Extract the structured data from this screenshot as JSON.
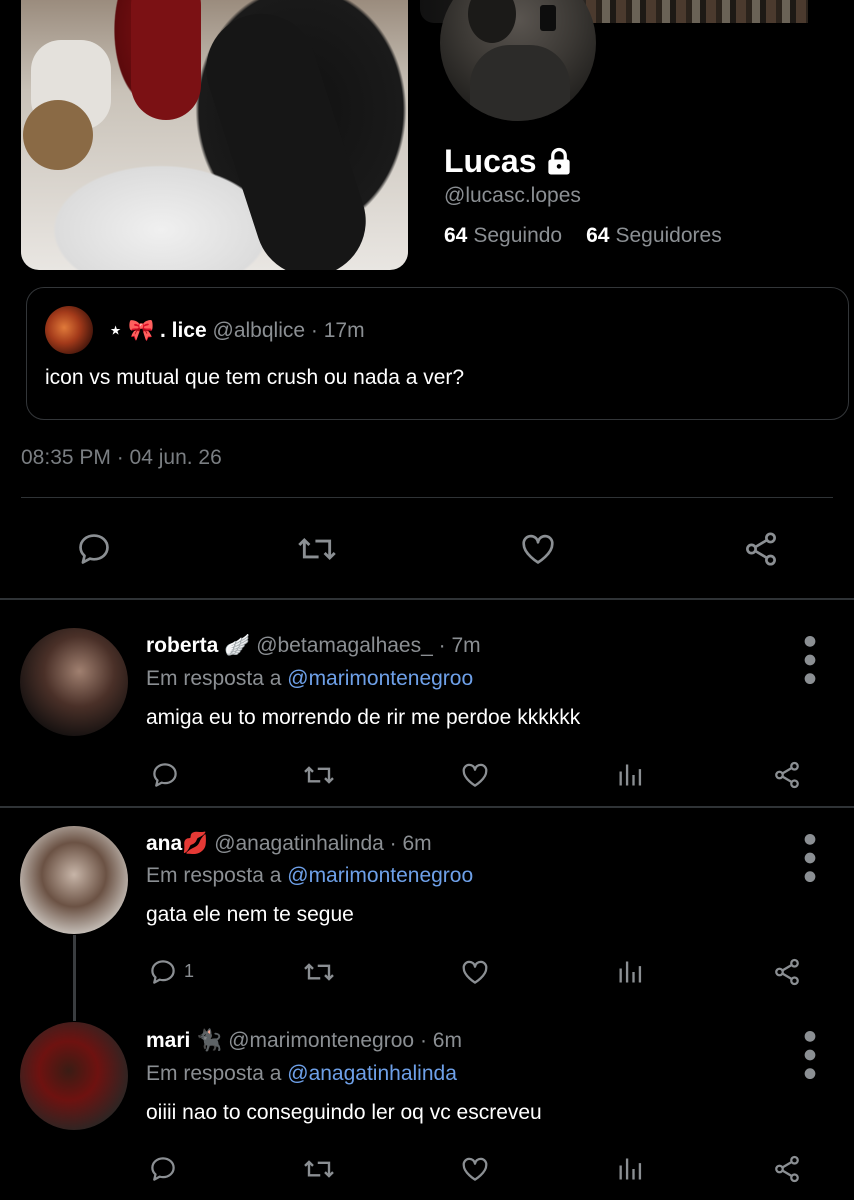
{
  "profile": {
    "name": "Lucas",
    "handle": "@lucasc.lopes",
    "following_count": "64",
    "following_label": "Seguindo",
    "followers_count": "64",
    "followers_label": "Seguidores",
    "lock_icon": "lock-icon"
  },
  "quoted_tweet": {
    "name": "⋆ 🎀 . lice",
    "handle": "@albqlice",
    "time": "· 17m",
    "text": "icon vs mutual que tem crush ou nada a ver?"
  },
  "timestamp": "08:35 PM · 04 jun. 26",
  "colors": {
    "background": "#000000",
    "text": "#e7e9ea",
    "muted": "#8b8f93",
    "link": "#6ea0e8",
    "divider": "#2f3336"
  },
  "replies": [
    {
      "name": "roberta 🪽",
      "handle": "@betamagalhaes_",
      "time": "· 7m",
      "reply_to_prefix": "Em resposta a",
      "reply_to": "@marimontenegroo",
      "text": "amiga eu to morrendo de rir me perdoe kkkkkk",
      "reply_count": ""
    },
    {
      "name": "ana💋",
      "handle": "@anagatinhalinda",
      "time": "· 6m",
      "reply_to_prefix": "Em resposta a",
      "reply_to": "@marimontenegroo",
      "text": "gata ele nem te segue",
      "reply_count": "1"
    },
    {
      "name": "mari 🐈‍⬛",
      "handle": "@marimontenegroo",
      "time": "· 6m",
      "reply_to_prefix": "Em resposta a",
      "reply_to": "@anagatinhalinda",
      "text": "oiiii nao to conseguindo ler oq vc escreveu",
      "reply_count": ""
    }
  ],
  "icons": [
    "reply-icon",
    "retweet-icon",
    "like-icon",
    "views-icon",
    "share-icon",
    "more-icon"
  ]
}
